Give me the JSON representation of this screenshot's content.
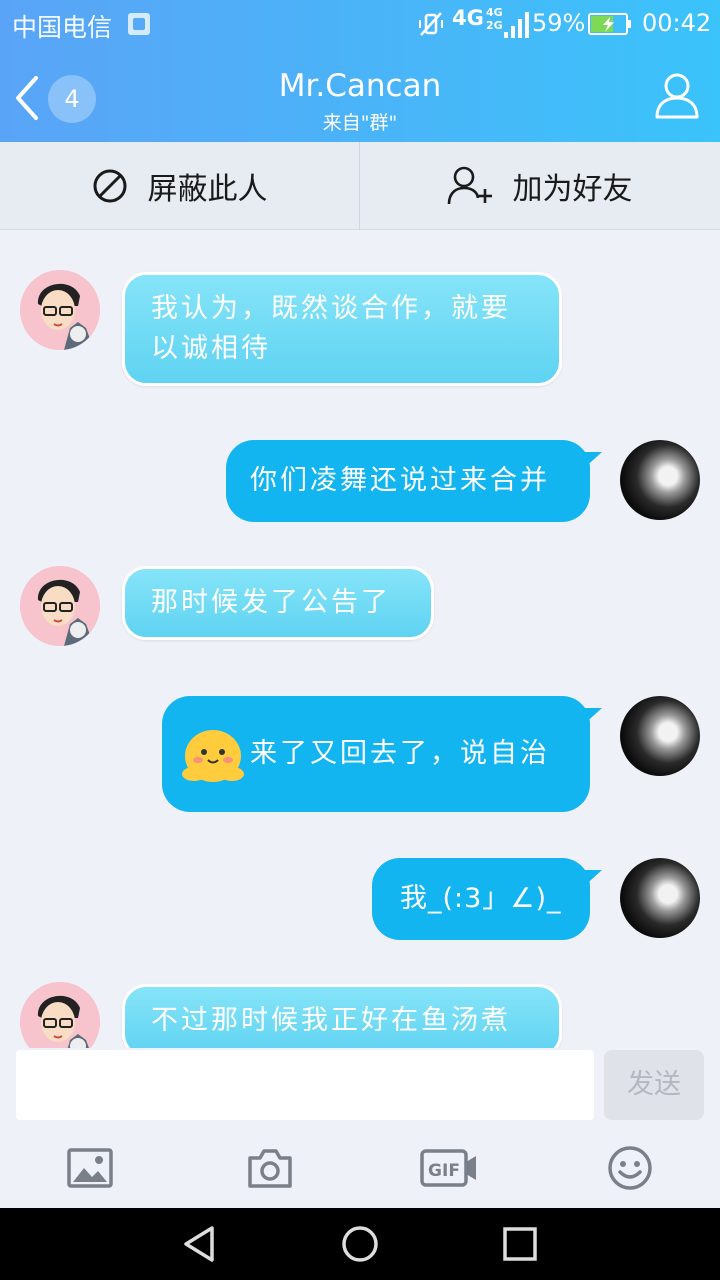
{
  "status_bar": {
    "carrier": "中国电信",
    "network": "4G",
    "network_small_1": "4G",
    "network_small_2": "2G",
    "battery": "59%",
    "time": "00:42"
  },
  "header": {
    "unread_count": "4",
    "title": "Mr.Cancan",
    "subtitle": "来自\"群\"",
    "back_icon": "chevron-left-icon",
    "profile_icon": "person-icon"
  },
  "actions": {
    "block_label": "屏蔽此人",
    "add_friend_label": "加为好友"
  },
  "messages": [
    {
      "side": "in",
      "text": "我认为，既然谈合作，就要以诚相待"
    },
    {
      "side": "out",
      "text": "你们凌舞还说过来合并"
    },
    {
      "side": "in",
      "text": "那时候发了公告了"
    },
    {
      "side": "out",
      "text": "来了又回去了，说自治",
      "emoji": "smiling-face-sticker"
    },
    {
      "side": "out",
      "text": "我_(:3」∠)_"
    },
    {
      "side": "in",
      "text": "不过那时候我正好在鱼汤煮"
    }
  ],
  "composer": {
    "input_value": "",
    "send_label": "发送"
  },
  "toolbar": {
    "gif_label": "GIF",
    "icons": [
      "image-icon",
      "camera-icon",
      "gif-icon",
      "emoji-icon"
    ]
  },
  "colors": {
    "header_gradient_start": "#5aa4f7",
    "header_gradient_end": "#3bc3fb",
    "incoming_bubble": "#6fdcf5",
    "outgoing_bubble": "#12b5ef",
    "background": "#eef1f7"
  }
}
